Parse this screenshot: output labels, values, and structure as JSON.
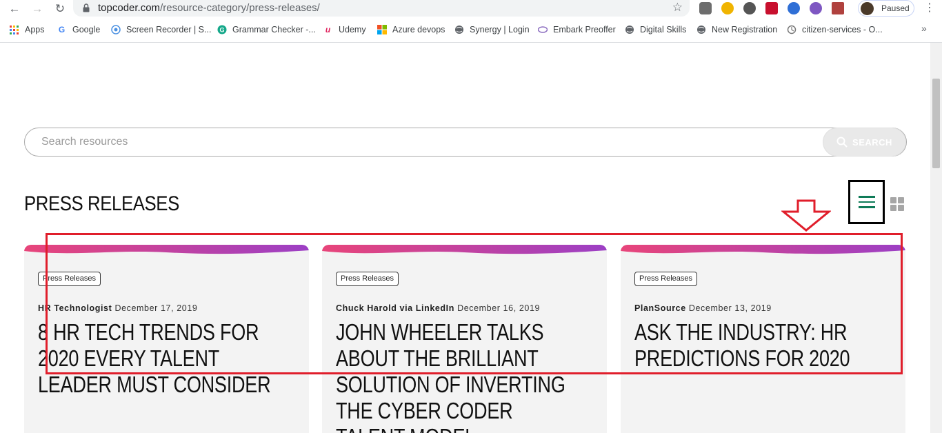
{
  "browser": {
    "url_domain": "topcoder.com",
    "url_path": "/resource-category/press-releases/",
    "profile_label": "Paused",
    "bookmarks": [
      {
        "label": "Apps",
        "icon": "apps-grid-icon"
      },
      {
        "label": "Google",
        "icon": "google-icon"
      },
      {
        "label": "Screen Recorder | S...",
        "icon": "screen-recorder-icon"
      },
      {
        "label": "Grammar Checker -...",
        "icon": "grammarly-icon"
      },
      {
        "label": "Udemy",
        "icon": "udemy-icon"
      },
      {
        "label": "Azure devops",
        "icon": "microsoft-icon"
      },
      {
        "label": "Synergy | Login",
        "icon": "globe-icon"
      },
      {
        "label": "Embark Preoffer",
        "icon": "embark-icon"
      },
      {
        "label": "Digital Skills",
        "icon": "globe-icon"
      },
      {
        "label": "New Registration",
        "icon": "globe-icon"
      },
      {
        "label": "citizen-services - O...",
        "icon": "citizen-services-icon"
      }
    ]
  },
  "search": {
    "placeholder": "Search resources",
    "button_label": "SEARCH"
  },
  "page": {
    "title": "PRESS RELEASES"
  },
  "colors": {
    "accent_green": "#0f7b58",
    "wave_start": "#e8457a",
    "wave_end": "#9c3fc5",
    "annotation_red": "#e01e2b"
  },
  "cards": [
    {
      "tag": "Press Releases",
      "source": "HR Technologist",
      "date": "December 17, 2019",
      "title": "8 HR TECH TRENDS FOR 2020 EVERY TALENT LEADER MUST CONSIDER"
    },
    {
      "tag": "Press Releases",
      "source": "Chuck Harold via LinkedIn",
      "date": "December 16, 2019",
      "title": "JOHN WHEELER TALKS ABOUT THE BRILLIANT SOLUTION OF INVERTING THE CYBER CODER TALENT MODEL"
    },
    {
      "tag": "Press Releases",
      "source": "PlanSource",
      "date": "December 13, 2019",
      "title": "ASK THE INDUSTRY: HR PREDICTIONS FOR 2020"
    }
  ]
}
